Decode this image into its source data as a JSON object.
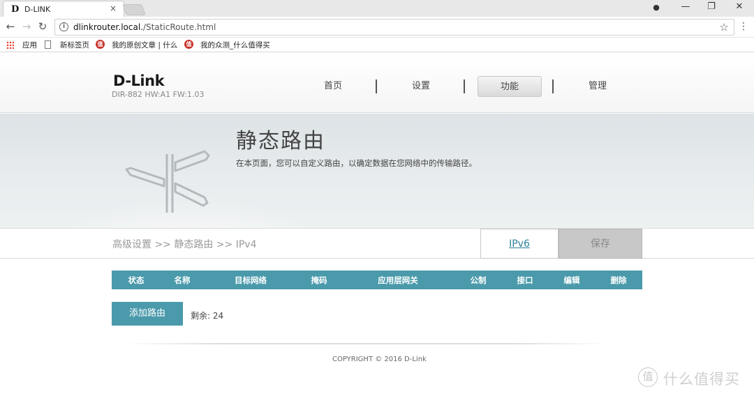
{
  "browser": {
    "tab_favicon": "D",
    "tab_title": "D-LINK",
    "tab_close": "×",
    "profile_icon": "●",
    "minimize": "—",
    "restore": "❐",
    "close": "✕",
    "back": "←",
    "forward": "→",
    "reload": "↻",
    "url_host": "dlinkrouter.local.",
    "url_path": "/StaticRoute.html",
    "star": "☆",
    "menu": "⋮",
    "bookmarks": [
      {
        "label": "应用"
      },
      {
        "label": "新标签页"
      },
      {
        "label": "我的原创文章 | 什么"
      },
      {
        "label": "我的众测_什么值得买"
      }
    ]
  },
  "header": {
    "logo": "D-Link",
    "model": "DIR-882 HW:A1 FW:1.03",
    "nav": [
      {
        "label": "首页"
      },
      {
        "label": "设置"
      },
      {
        "label": "功能",
        "active": true
      },
      {
        "label": "管理"
      }
    ]
  },
  "banner": {
    "title": "静态路由",
    "description": "在本页面，您可以自定义路由，以确定数据在您网络中的传输路径。"
  },
  "crumb": {
    "path": "高级设置 >> 静态路由 >> IPv4",
    "ipv6": "IPv6",
    "save": "保存"
  },
  "table": {
    "headers": [
      "状态",
      "名称",
      "目标网络",
      "掩码",
      "应用层网关",
      "公制",
      "接口",
      "编辑",
      "删除"
    ]
  },
  "actions": {
    "add_route": "添加路由",
    "remaining": "剩余: 24"
  },
  "footer": {
    "copyright": "COPYRIGHT © 2016 D-Link"
  },
  "watermark": {
    "badge": "值",
    "text": "什么值得买"
  },
  "colors": {
    "accent": "#4a9aab",
    "link": "#2a7f98",
    "disabled": "#c8c8c8"
  }
}
